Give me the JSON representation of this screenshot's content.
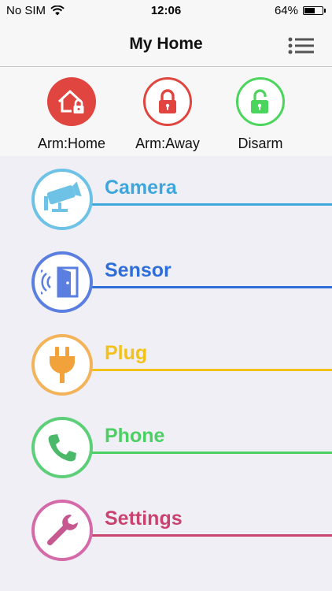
{
  "status_bar": {
    "carrier": "No SIM",
    "time": "12:06",
    "battery_percent": "64%",
    "battery_level": 0.64
  },
  "nav": {
    "title": "My Home",
    "menu_icon": "list-menu-icon"
  },
  "arm_modes": [
    {
      "label": "Arm:Home",
      "icon": "home-lock-icon",
      "color": "#e0463f",
      "style": "filled"
    },
    {
      "label": "Arm:Away",
      "icon": "padlock-icon",
      "color": "#e0463f",
      "style": "outline"
    },
    {
      "label": "Disarm",
      "icon": "unlocked-padlock-icon",
      "color": "#4cd55c",
      "style": "outline"
    }
  ],
  "menu_items": [
    {
      "label": "Camera",
      "icon": "camera-icon",
      "color": "#3fa6dc",
      "ring_color": "#6ec2e6"
    },
    {
      "label": "Sensor",
      "icon": "door-sensor-icon",
      "color": "#2f6ed8",
      "ring_color": "#5b7fe0"
    },
    {
      "label": "Plug",
      "icon": "plug-icon",
      "color": "#f2c21a",
      "ring_color": "#f2b35a"
    },
    {
      "label": "Phone",
      "icon": "phone-icon",
      "color": "#4ccf63",
      "ring_color": "#5ccf78"
    },
    {
      "label": "Settings",
      "icon": "wrench-icon",
      "color": "#c9436e",
      "ring_color": "#d46aa8"
    }
  ]
}
